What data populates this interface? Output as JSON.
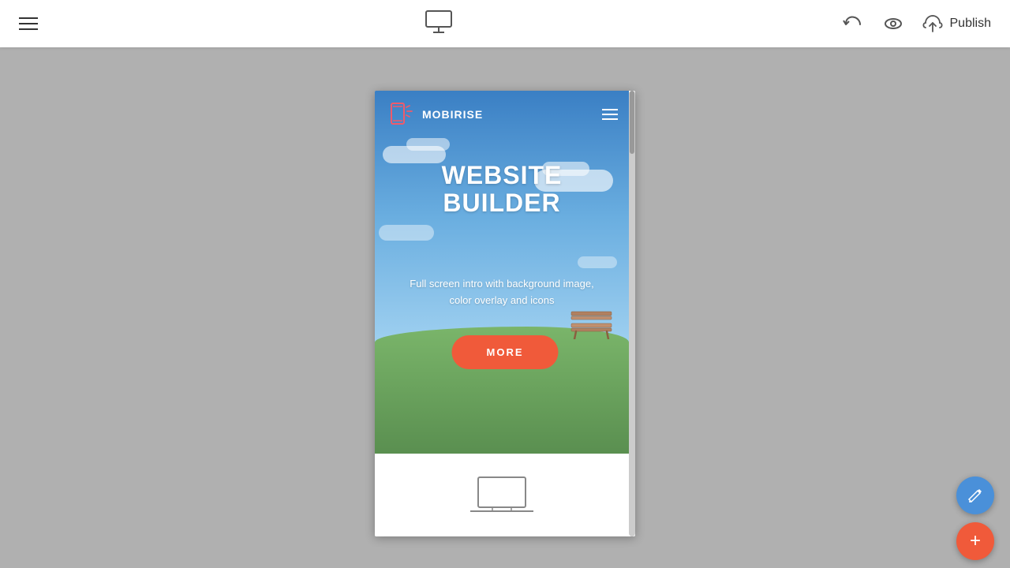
{
  "toolbar": {
    "publish_label": "Publish",
    "menu_icon": "hamburger-menu",
    "monitor_icon": "monitor",
    "undo_icon": "undo",
    "eye_icon": "preview"
  },
  "mobile_preview": {
    "nav": {
      "logo_text": "MOBIRISE",
      "hamburger_icon": "mobile-menu"
    },
    "hero": {
      "title_line1": "WEBSITE",
      "title_line2": "BUILDER",
      "subtitle": "Full screen intro with background image, color overlay and icons",
      "button_label": "MORE"
    }
  },
  "fab": {
    "edit_icon": "pencil",
    "add_icon": "+"
  }
}
